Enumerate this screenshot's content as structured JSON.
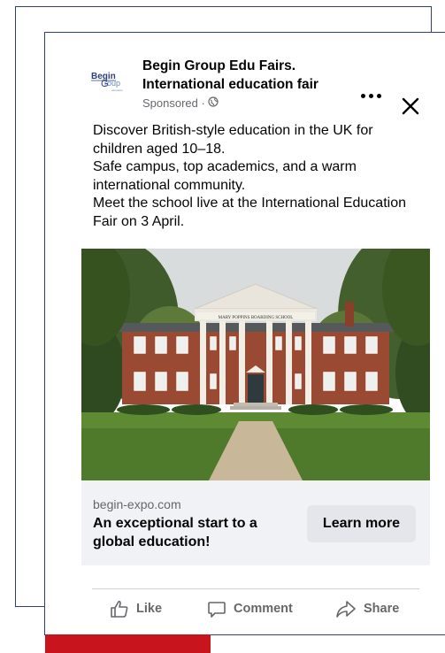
{
  "ad": {
    "page_name": "Begin Group Edu Fairs. International education fair",
    "sponsored_label": "Sponsored ·",
    "logo_text": "Begin Group",
    "body_lines": [
      "Discover British-style education in the UK for children aged 10–18.",
      "Safe campus, top academics, and a warm international community.",
      "Meet the school live at the International Education Fair on 3 April."
    ],
    "image_sign": "MARY POPPINS BOARDING SCHOOL",
    "link_domain": "begin-expo.com",
    "link_headline": "An exceptional start to a global education!",
    "cta_label": "Learn more"
  },
  "actions": {
    "like": "Like",
    "comment": "Comment",
    "share": "Share"
  },
  "colors": {
    "frame_border": "#2d3f7a",
    "accent_red": "#c8151d",
    "link_bar_bg": "#f0f2f5",
    "cta_bg": "#e4e6eb",
    "secondary_text": "#65676b"
  },
  "icons": [
    "more-icon",
    "close-icon",
    "globe-icon",
    "like-icon",
    "comment-icon",
    "share-icon"
  ]
}
